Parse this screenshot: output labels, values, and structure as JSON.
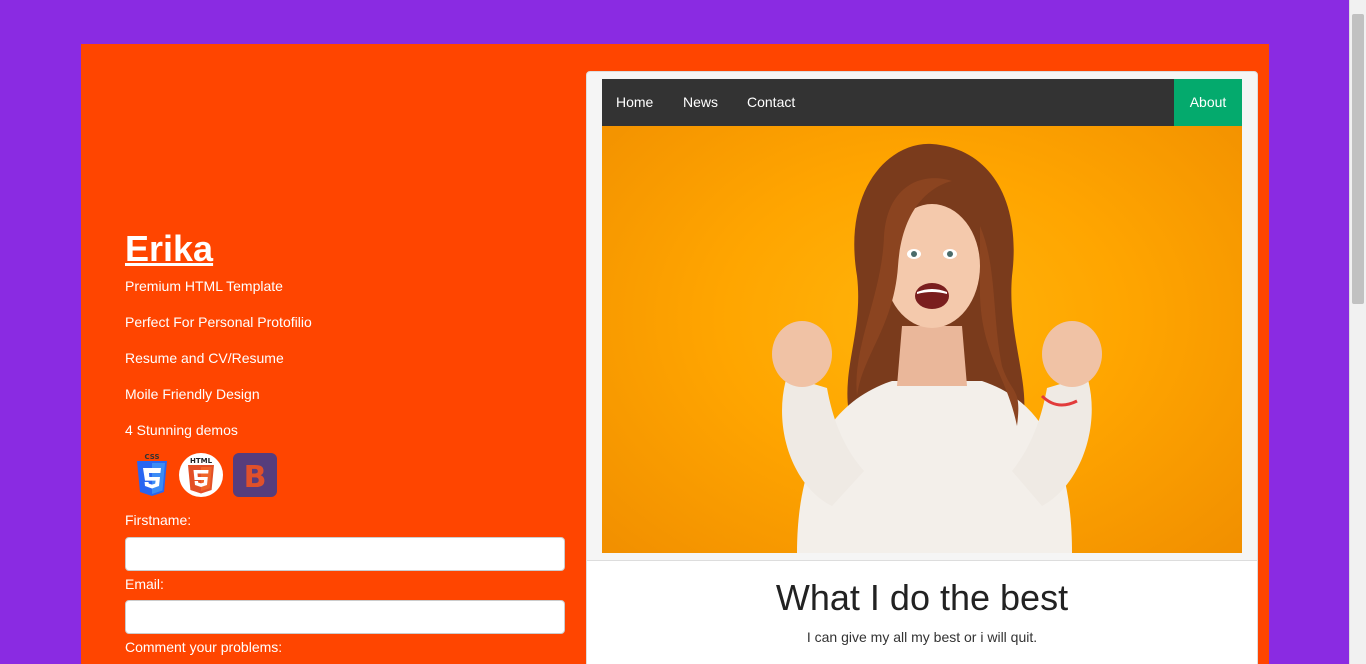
{
  "colors": {
    "page_background": "#8a2be2",
    "panel_background": "#ff4500",
    "navbar_background": "#333333",
    "nav_active": "#04aa6d",
    "hero_background": "#ffa500"
  },
  "sidebar": {
    "title": "Erika",
    "features": [
      "Premium HTML Template",
      "Perfect For Personal Protofilio",
      "Resume and CV/Resume",
      "Moile Friendly Design",
      "4 Stunning demos"
    ],
    "tech_icons": [
      {
        "name": "css3-icon",
        "label": "CSS"
      },
      {
        "name": "html5-icon",
        "label": "HTML"
      },
      {
        "name": "bootstrap-icon",
        "label": "B"
      }
    ]
  },
  "form": {
    "firstname_label": "Firstname:",
    "firstname_value": "",
    "email_label": "Email:",
    "email_value": "",
    "comment_label": "Comment your problems:"
  },
  "nav": {
    "items": [
      "Home",
      "News",
      "Contact"
    ],
    "active": "About"
  },
  "hero": {
    "image_icon": "woman-celebrating-photo"
  },
  "card": {
    "title": "What I do the best",
    "text": "I can give my all my best or i will quit."
  }
}
